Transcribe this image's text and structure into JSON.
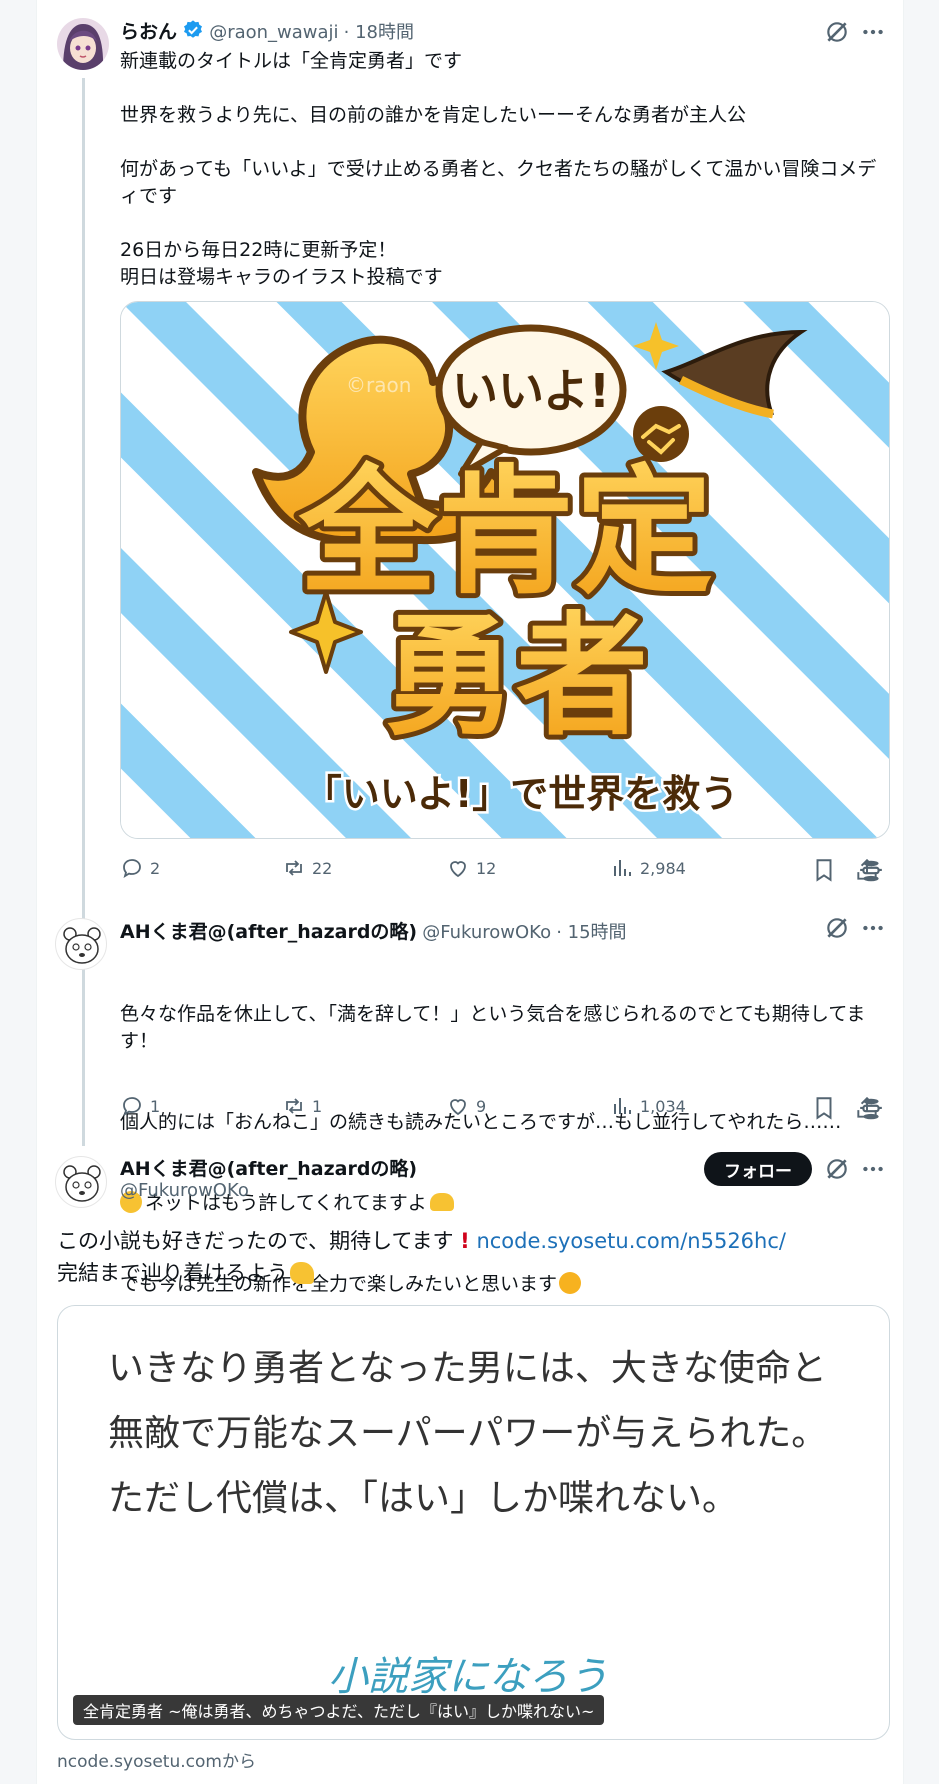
{
  "post1": {
    "display_name": "らおん",
    "handle": "@raon_wawaji",
    "time": "· 18時間",
    "text": "新連載のタイトルは「全肯定勇者」です\n\n世界を救うより先に、目の前の誰かを肯定したいーーそんな勇者が主人公\n\n何があっても「いいよ」で受け止める勇者と、クセ者たちの騒がしくて温かい冒険コメディです\n\n26日から毎日22時に更新予定！\n明日は登場キャラのイラスト投稿です",
    "image": {
      "speech": "いいよ!",
      "title_line1": "全肯定",
      "title_line2": "勇者",
      "subtitle": "「いいよ!」で世界を救う",
      "watermark": "©raon"
    },
    "stats": {
      "replies": "2",
      "reposts": "22",
      "likes": "12",
      "views": "2,984"
    }
  },
  "post2": {
    "display_name": "AHくま君@(after_hazardの略)",
    "handle": "@FukurowOKo",
    "time": "· 15時間",
    "text_line1": "色々な作品を休止して、「満を辞して！」という気合を感じられるのでとても期待してます！",
    "text_line2": "個人的には「おんねこ」の続きも読みたいところですが…もし並行してやれたら……",
    "text_line3": "ネットはもう許してくれてますよ",
    "text_line4": "でも今は先生の新作を全力で楽しみたいと思います",
    "stats": {
      "replies": "1",
      "reposts": "1",
      "likes": "9",
      "views": "1,034"
    }
  },
  "post3": {
    "display_name": "AHくま君@(after_hazardの略)",
    "handle": "@FukurowOKo",
    "follow_label": "フォロー",
    "text_part1": "この小説も好きだったので、期待してます",
    "link": "ncode.syosetu.com/n5526hc/",
    "text_part2": "完結まで辿り着けるよう",
    "card": {
      "body": "いきなり勇者となった男には、大きな使命と無敵で万能なスーパーパワーが与えられた。　ただし代償は、「はい」しか喋れない。",
      "logo": "小説家になろう",
      "title": "全肯定勇者 ~俺は勇者、めちゃつよだ、ただし『はい』しか喋れない~",
      "source": "ncode.syosetu.comから"
    }
  },
  "colors": {
    "accent": "#1d9bf0",
    "muted": "#536471",
    "link": "#1d70b8"
  }
}
